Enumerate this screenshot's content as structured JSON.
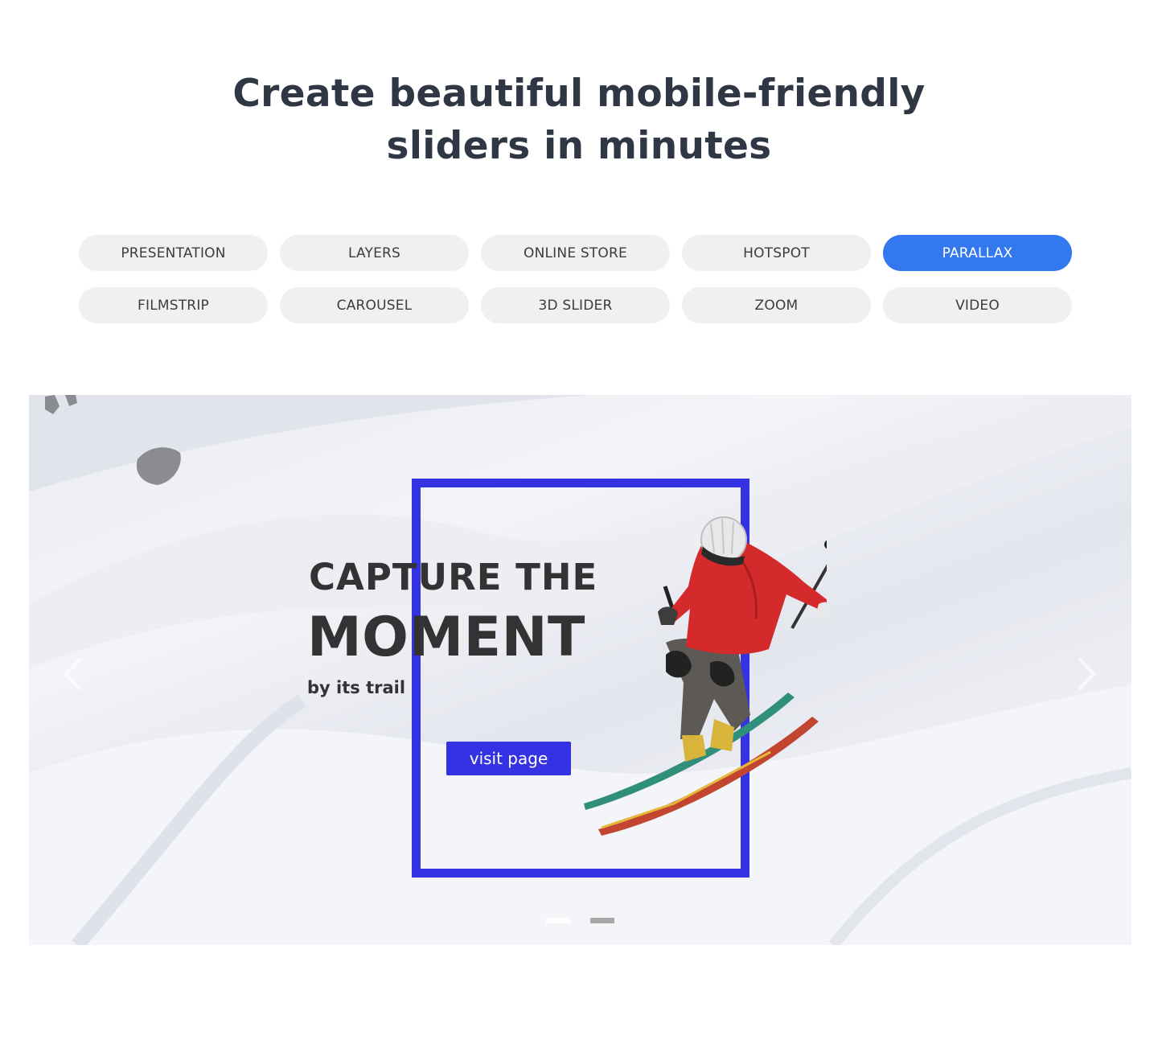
{
  "headline": {
    "line1": "Create beautiful mobile-friendly",
    "line2": "sliders in minutes"
  },
  "tabs": [
    {
      "label": "PRESENTATION",
      "active": false
    },
    {
      "label": "LAYERS",
      "active": false
    },
    {
      "label": "ONLINE STORE",
      "active": false
    },
    {
      "label": "HOTSPOT",
      "active": false
    },
    {
      "label": "PARALLAX",
      "active": true
    },
    {
      "label": "FILMSTRIP",
      "active": false
    },
    {
      "label": "CAROUSEL",
      "active": false
    },
    {
      "label": "3D SLIDER",
      "active": false
    },
    {
      "label": "ZOOM",
      "active": false
    },
    {
      "label": "VIDEO",
      "active": false
    }
  ],
  "slide": {
    "title_line1": "CAPTURE THE",
    "title_line2": "MOMENT",
    "subtitle": "by its trail",
    "button_label": "visit page"
  },
  "slider": {
    "current_slide": 1,
    "total_slides": 2,
    "prev_icon": "chevron-left-icon",
    "next_icon": "chevron-right-icon"
  },
  "colors": {
    "accent": "#3478ef",
    "frame": "#3532e3",
    "heading": "#2f3744"
  }
}
